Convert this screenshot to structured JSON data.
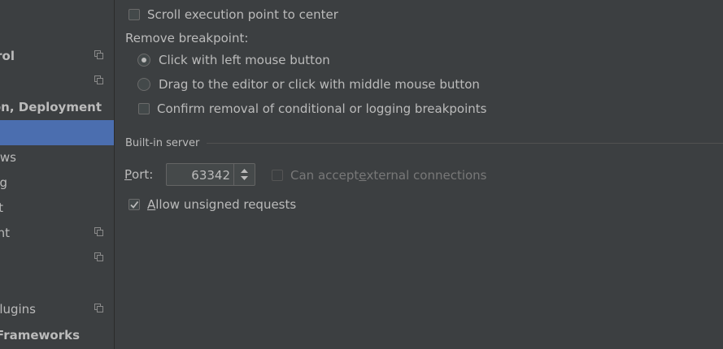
{
  "sidebar": {
    "items": [
      {
        "label": "rol",
        "bold": true,
        "copy": true
      },
      {
        "label": "",
        "bold": false,
        "copy": true
      },
      {
        "label": "ion, Deployment",
        "bold": true,
        "copy": false
      },
      {
        "label": "",
        "bold": false,
        "copy": false,
        "selected": true
      },
      {
        "label": "ws",
        "bold": false,
        "copy": false
      },
      {
        "label": "g",
        "bold": false,
        "copy": false
      },
      {
        "label": "t",
        "bold": false,
        "copy": false
      },
      {
        "label": "nt",
        "bold": false,
        "copy": true
      },
      {
        "label": "",
        "bold": false,
        "copy": true
      },
      {
        "label": "",
        "bold": false,
        "copy": false
      },
      {
        "label": "lugins",
        "bold": false,
        "copy": true
      },
      {
        "label": "Frameworks",
        "bold": true,
        "copy": false
      }
    ]
  },
  "debugger": {
    "scroll_center_label": "Scroll execution point to center",
    "scroll_center_checked": false,
    "remove_breakpoint_label": "Remove breakpoint:",
    "radio_left_click": "Click with left mouse button",
    "radio_drag": "Drag to the editor or click with middle mouse button",
    "selected_radio": "left_click",
    "confirm_removal_label": "Confirm removal of conditional or logging breakpoints",
    "confirm_removal_checked": false
  },
  "server": {
    "section_title": "Built-in server",
    "port_label_mnemonic": "P",
    "port_label_rest": "ort:",
    "port_value": "63342",
    "external_pre": "Can accept ",
    "external_mnemonic": "e",
    "external_post": "xternal connections",
    "external_checked": false,
    "unsigned_mnemonic": "A",
    "unsigned_rest": "llow unsigned requests",
    "unsigned_checked": true
  },
  "colors": {
    "background": "#3c3f41",
    "selection": "#4b6eaf",
    "text": "#bbbbbb",
    "disabled_text": "#787878"
  }
}
